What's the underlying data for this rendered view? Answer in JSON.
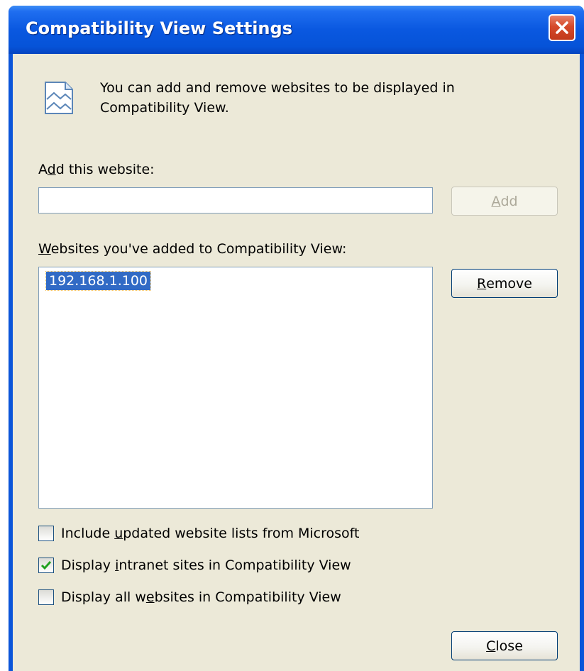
{
  "window": {
    "title": "Compatibility View Settings"
  },
  "description": "You can add and remove websites to be displayed in Compatibility View.",
  "add_section": {
    "label_pre": "A",
    "label_accel": "d",
    "label_post": "d this website:",
    "input_value": "",
    "button_pre": "",
    "button_accel": "A",
    "button_post": "dd",
    "button_enabled": false
  },
  "sites_section": {
    "label_pre": "",
    "label_accel": "W",
    "label_post": "ebsites you've added to Compatibility View:",
    "items": [
      "192.168.1.100"
    ],
    "selected_index": 0,
    "remove_pre": "",
    "remove_accel": "R",
    "remove_post": "emove"
  },
  "options": [
    {
      "pre": "Include ",
      "accel": "u",
      "post": "pdated website lists from Microsoft",
      "checked": false
    },
    {
      "pre": "Display ",
      "accel": "i",
      "post": "ntranet sites in Compatibility View",
      "checked": true
    },
    {
      "pre": "Display all w",
      "accel": "e",
      "post": "bsites in Compatibility View",
      "checked": false
    }
  ],
  "footer": {
    "close_pre": "",
    "close_accel": "C",
    "close_post": "lose"
  },
  "colors": {
    "titlebar": "#0a58e0",
    "dialog_bg": "#ece9d8",
    "selection": "#316ac5",
    "close_button": "#d5492a",
    "checkmark": "#21a121"
  },
  "icons": {
    "title_close": "close-icon",
    "info": "webpage-compat-icon",
    "check": "checkmark-icon"
  }
}
